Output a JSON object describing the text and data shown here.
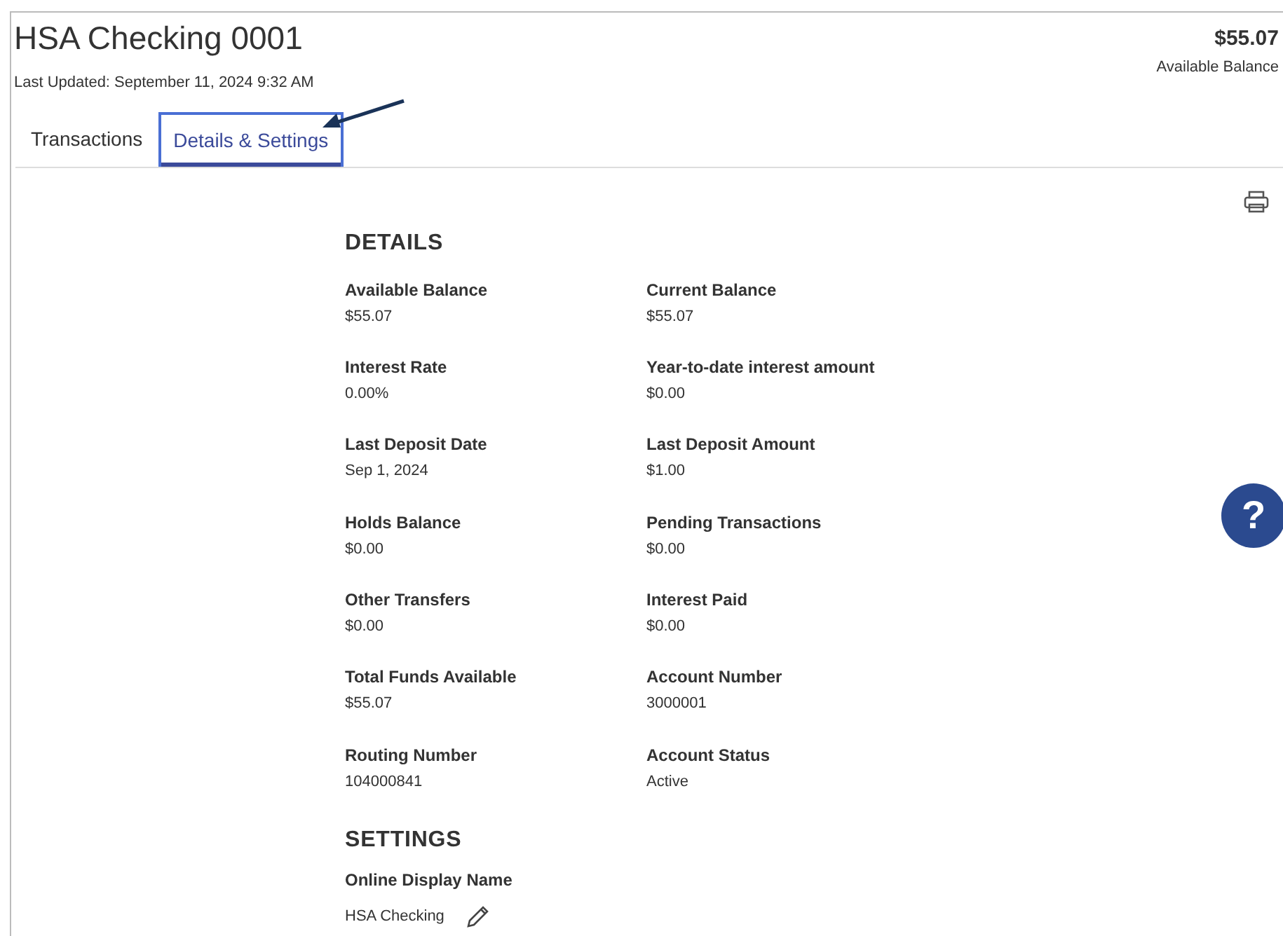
{
  "account": {
    "title": "HSA Checking 0001",
    "last_updated": "Last Updated: September 11, 2024 9:32 AM",
    "balance": "$55.07",
    "balance_label": "Available Balance"
  },
  "tabs": [
    {
      "label": "Transactions",
      "selected": false
    },
    {
      "label": "Details & Settings",
      "selected": true
    }
  ],
  "details": {
    "heading": "DETAILS",
    "fields": [
      {
        "label": "Available Balance",
        "value": "$55.07"
      },
      {
        "label": "Current Balance",
        "value": "$55.07"
      },
      {
        "label": "Interest Rate",
        "value": "0.00%"
      },
      {
        "label": "Year-to-date interest amount",
        "value": "$0.00"
      },
      {
        "label": "Last Deposit Date",
        "value": "Sep 1, 2024"
      },
      {
        "label": "Last Deposit Amount",
        "value": "$1.00"
      },
      {
        "label": "Holds Balance",
        "value": "$0.00"
      },
      {
        "label": "Pending Transactions",
        "value": "$0.00"
      },
      {
        "label": "Other Transfers",
        "value": "$0.00"
      },
      {
        "label": "Interest Paid",
        "value": "$0.00"
      },
      {
        "label": "Total Funds Available",
        "value": "$55.07"
      },
      {
        "label": "Account Number",
        "value": "3000001"
      },
      {
        "label": "Routing Number",
        "value": "104000841"
      },
      {
        "label": "Account Status",
        "value": "Active"
      }
    ]
  },
  "settings": {
    "heading": "SETTINGS",
    "label": "Online Display Name",
    "value": "HSA Checking"
  },
  "help_button": {
    "label": "?"
  }
}
